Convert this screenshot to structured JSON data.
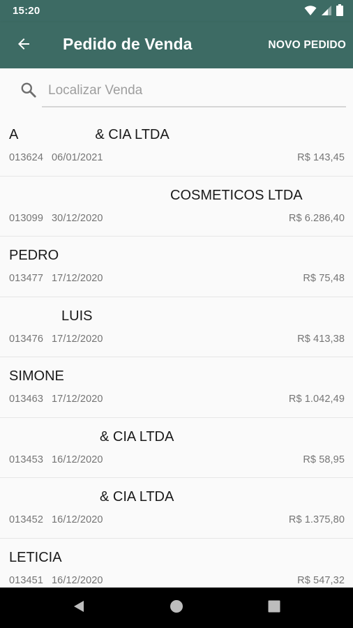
{
  "status_bar": {
    "time": "15:20",
    "icons": [
      "wifi-icon",
      "signal-icon",
      "battery-icon"
    ]
  },
  "app_bar": {
    "title": "Pedido de Venda",
    "action_label": "NOVO PEDIDO",
    "back_icon": "arrow-left-icon"
  },
  "search": {
    "placeholder": "Localizar Venda",
    "value": ""
  },
  "orders": [
    {
      "name": "A                    & CIA LTDA",
      "code": "013624",
      "date": "06/01/2021",
      "value": "R$ 143,45"
    },
    {
      "name": "COSMETICOS LTDA",
      "code": "013099",
      "date": "30/12/2020",
      "value": "R$ 6.286,40"
    },
    {
      "name": "PEDRO",
      "code": "013477",
      "date": "17/12/2020",
      "value": "R$ 75,48"
    },
    {
      "name": "LUIS",
      "code": "013476",
      "date": "17/12/2020",
      "value": "R$ 413,38"
    },
    {
      "name": "SIMONE",
      "code": "013463",
      "date": "17/12/2020",
      "value": "R$ 1.042,49"
    },
    {
      "name": "& CIA LTDA",
      "code": "013453",
      "date": "16/12/2020",
      "value": "R$ 58,95"
    },
    {
      "name": "& CIA LTDA",
      "code": "013452",
      "date": "16/12/2020",
      "value": "R$ 1.375,80"
    },
    {
      "name": "LETICIA",
      "code": "013451",
      "date": "16/12/2020",
      "value": "R$ 547,32"
    }
  ],
  "colors": {
    "primary": "#3d6b64",
    "background": "#fafafa",
    "secondary_text": "#757575",
    "navigation_bar": "#000000"
  },
  "nav_bar": {
    "buttons": [
      "back-triangle-icon",
      "home-circle-icon",
      "recents-square-icon"
    ]
  }
}
